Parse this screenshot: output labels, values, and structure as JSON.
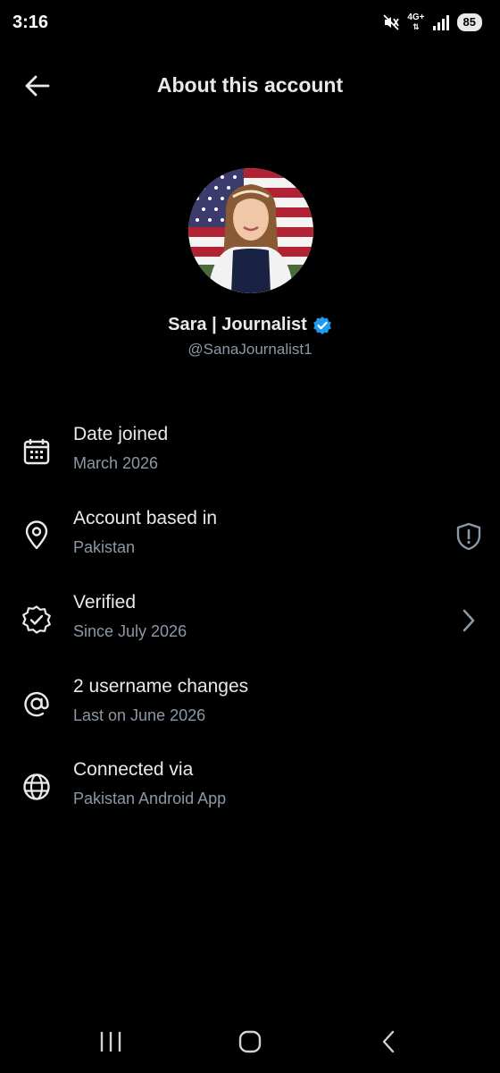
{
  "status_bar": {
    "time": "3:16",
    "network": "4G+",
    "battery": "85",
    "icons": [
      "mute-icon",
      "network-arrows-icon",
      "signal-icon",
      "battery-icon"
    ]
  },
  "header": {
    "title": "About this account",
    "back_icon": "back-arrow-icon"
  },
  "profile": {
    "name": "Sara | Journalist",
    "handle": "@SanaJournalist1",
    "verified_icon": "verified-badge-icon",
    "badge_color": "#1d9bf0"
  },
  "rows": [
    {
      "title": "Date joined",
      "subtitle": "March 2026",
      "icon": "calendar-icon"
    },
    {
      "title": "Account based in",
      "subtitle": "Pakistan",
      "icon": "location-pin-icon",
      "trailing_icon": "shield-alert-icon"
    },
    {
      "title": "Verified",
      "subtitle": "Since July 2026",
      "icon": "verified-outline-icon",
      "trailing_icon": "chevron-right-icon"
    },
    {
      "title": "2 username changes",
      "subtitle": "Last on June 2026",
      "icon": "at-sign-icon"
    },
    {
      "title": "Connected via",
      "subtitle": "Pakistan Android App",
      "icon": "globe-icon"
    }
  ],
  "nav_bar": {
    "icons": [
      "recent-apps-icon",
      "home-icon",
      "back-icon"
    ]
  },
  "colors": {
    "background": "#000000",
    "primary_text": "#e7e9ea",
    "secondary_text": "#8b98a5",
    "accent": "#1d9bf0"
  }
}
